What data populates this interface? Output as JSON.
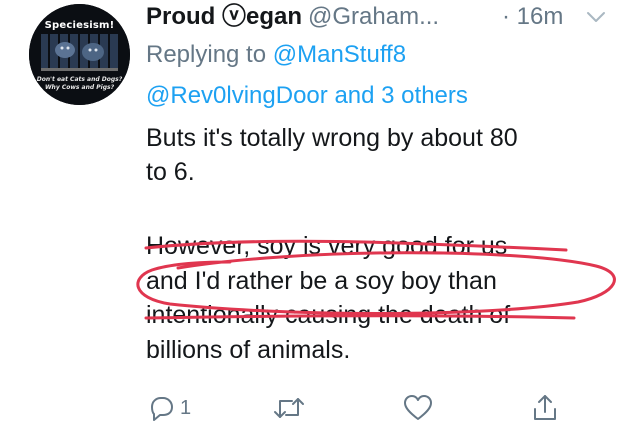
{
  "tweet": {
    "display_name": "Proud ⓥegan",
    "handle": "@Graham...",
    "timestamp": "· 16m",
    "avatar": {
      "top_text": "Speciesism!",
      "bottom_line_1": "Don't eat Cats and Dogs?",
      "bottom_line_2": "Why Cows and Pigs?"
    },
    "replying_to": {
      "prefix": "Replying to",
      "first_mention": "@ManStuff8",
      "second_mention": "@Rev0lvingDoor",
      "others": "and 3 others"
    },
    "body_lines": [
      "Buts it's totally wrong by about 80",
      "to 6.",
      "However, soy is very good for us",
      "and I'd rather be a soy boy than",
      "intentionally causing the death of",
      "billions of animals."
    ],
    "actions": {
      "reply_count": "1"
    },
    "colors": {
      "text": "#14171a",
      "secondary": "#657786",
      "accent": "#1da1f2",
      "annotation": "#e0364f"
    },
    "icons": {
      "reply": "reply-icon",
      "retweet": "retweet-icon",
      "like": "heart-icon",
      "share": "share-icon",
      "menu": "chevron-down-icon"
    }
  }
}
